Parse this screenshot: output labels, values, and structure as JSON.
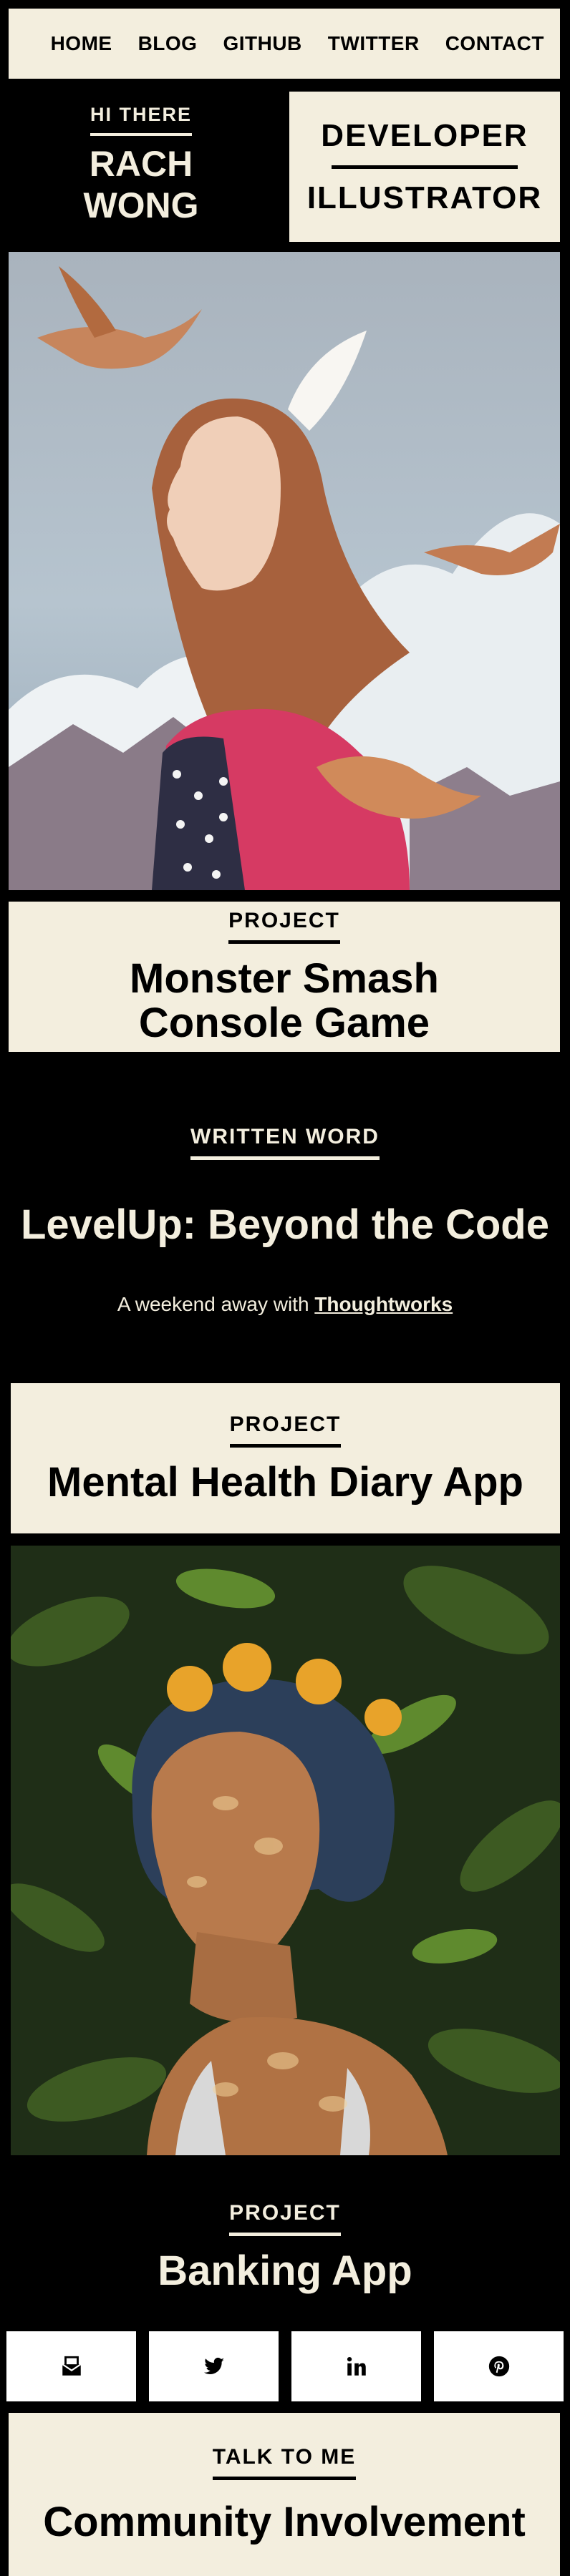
{
  "nav": {
    "links": [
      "HOME",
      "BLOG",
      "GITHUB",
      "TWITTER",
      "CONTACT"
    ]
  },
  "hero": {
    "greeting": "HI THERE",
    "name_line1": "RACH",
    "name_line2": "WONG",
    "role1": "DEVELOPER",
    "role2": "ILLUSTRATOR"
  },
  "project1": {
    "label": "PROJECT",
    "title_line1": "Monster Smash",
    "title_line2": "Console Game"
  },
  "written": {
    "label": "WRITTEN WORD",
    "title": "LevelUp: Beyond the Code",
    "sub_prefix": "A weekend away with ",
    "sub_link": "Thoughtworks"
  },
  "project2": {
    "label": "PROJECT",
    "title": "Mental Health Diary App"
  },
  "project3": {
    "label": "PROJECT",
    "title": "Banking App"
  },
  "social": {
    "icons": [
      "mail-icon",
      "twitter-icon",
      "linkedin-icon",
      "pinterest-icon"
    ]
  },
  "talk": {
    "label": "TALK TO ME",
    "title": "Community Involvement"
  },
  "colors": {
    "cream": "#f3eede",
    "black": "#000000"
  }
}
